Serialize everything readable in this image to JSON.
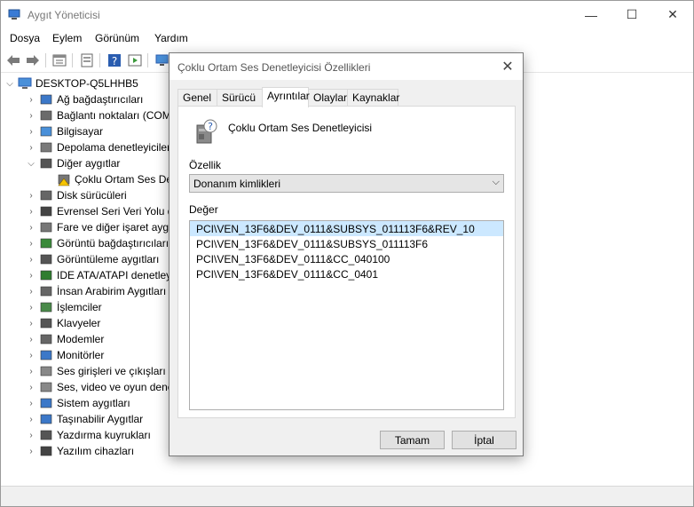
{
  "window": {
    "title": "Aygıt Yöneticisi",
    "controls": {
      "minimize": "—",
      "maximize": "☐",
      "close": "✕"
    }
  },
  "menu": [
    "Dosya",
    "Eylem",
    "Görünüm",
    "Yardım"
  ],
  "toolbar": {
    "icons": [
      "back-arrow-icon",
      "forward-arrow-icon",
      "properties-icon",
      "show-hidden-icon",
      "help-icon",
      "run-icon",
      "scan-hardware-icon"
    ]
  },
  "tree": {
    "root": "DESKTOP-Q5LHHB5",
    "items": [
      {
        "label": "Ağ bağdaştırıcıları",
        "icon": "network-adapter-icon",
        "expanded": false
      },
      {
        "label": "Bağlantı noktaları (COM",
        "icon": "port-icon",
        "expanded": false
      },
      {
        "label": "Bilgisayar",
        "icon": "computer-icon",
        "expanded": false
      },
      {
        "label": "Depolama denetleyiciler",
        "icon": "storage-controller-icon",
        "expanded": false
      },
      {
        "label": "Diğer aygıtlar",
        "icon": "other-devices-icon",
        "expanded": true
      },
      {
        "label": "Çoklu Ortam Ses Den",
        "icon": "warning-device-icon",
        "child": true
      },
      {
        "label": "Disk sürücüleri",
        "icon": "disk-drive-icon",
        "expanded": false
      },
      {
        "label": "Evrensel Seri Veri Yolu de",
        "icon": "usb-icon",
        "expanded": false
      },
      {
        "label": "Fare ve diğer işaret aygıt",
        "icon": "mouse-icon",
        "expanded": false
      },
      {
        "label": "Görüntü bağdaştırıcıları",
        "icon": "display-adapter-icon",
        "expanded": false
      },
      {
        "label": "Görüntüleme aygıtları",
        "icon": "camera-icon",
        "expanded": false
      },
      {
        "label": "IDE ATA/ATAPI denetleyi",
        "icon": "ide-controller-icon",
        "expanded": false
      },
      {
        "label": "İnsan Arabirim Aygıtları",
        "icon": "hid-icon",
        "expanded": false
      },
      {
        "label": "İşlemciler",
        "icon": "processor-icon",
        "expanded": false
      },
      {
        "label": "Klavyeler",
        "icon": "keyboard-icon",
        "expanded": false
      },
      {
        "label": "Modemler",
        "icon": "modem-icon",
        "expanded": false
      },
      {
        "label": "Monitörler",
        "icon": "monitor-icon",
        "expanded": false
      },
      {
        "label": "Ses girişleri ve çıkışları",
        "icon": "speaker-icon",
        "expanded": false
      },
      {
        "label": "Ses, video ve oyun dene",
        "icon": "sound-video-icon",
        "expanded": false
      },
      {
        "label": "Sistem aygıtları",
        "icon": "system-device-icon",
        "expanded": false
      },
      {
        "label": "Taşınabilir Aygıtlar",
        "icon": "portable-device-icon",
        "expanded": false
      },
      {
        "label": "Yazdırma kuyrukları",
        "icon": "printer-icon",
        "expanded": false
      },
      {
        "label": "Yazılım cihazları",
        "icon": "software-device-icon",
        "expanded": false
      }
    ]
  },
  "dialog": {
    "title": "Çoklu Ortam Ses Denetleyicisi Özellikleri",
    "tabs": [
      "Genel",
      "Sürücü",
      "Ayrıntılar",
      "Olaylar",
      "Kaynaklar"
    ],
    "active_tab": "Ayrıntılar",
    "device_name": "Çoklu Ortam Ses Denetleyicisi",
    "property_label": "Özellik",
    "property_value": "Donanım kimlikleri",
    "value_label": "Değer",
    "values": [
      "PCI\\VEN_13F6&DEV_0111&SUBSYS_011113F6&REV_10",
      "PCI\\VEN_13F6&DEV_0111&SUBSYS_011113F6",
      "PCI\\VEN_13F6&DEV_0111&CC_040100",
      "PCI\\VEN_13F6&DEV_0111&CC_0401"
    ],
    "selected_value_index": 0,
    "ok_label": "Tamam",
    "cancel_label": "İptal"
  },
  "colors": {
    "selection": "#cce8ff",
    "dialog_bg": "#f0f0f0",
    "button_bg": "#e1e1e1"
  }
}
